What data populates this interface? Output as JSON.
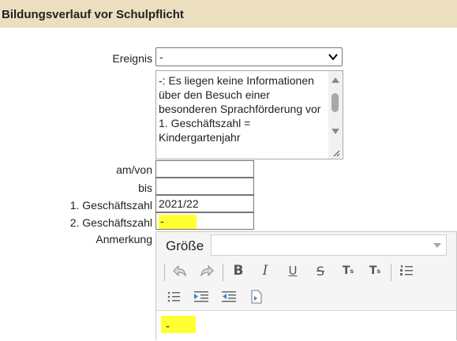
{
  "header": {
    "title": "Bildungsverlauf vor Schulpflicht"
  },
  "form": {
    "ereignis_label": "Ereignis",
    "ereignis_value": "-",
    "description": "-: Es liegen keine Informationen über den Besuch einer besonderen Sprachförderung vor 1. Geschäftszahl = Kindergartenjahr",
    "am_von_label": "am/von",
    "am_von_value": "",
    "bis_label": "bis",
    "bis_value": "",
    "gz1_label": "1. Geschäftszahl",
    "gz1_value": "2021/22",
    "gz2_label": "2. Geschäftszahl",
    "gz2_value": "-",
    "anmerkung_label": "Anmerkung"
  },
  "editor": {
    "size_label": "Größe",
    "size_value": "",
    "toolbar": [
      "undo-icon",
      "redo-icon",
      "bold-icon",
      "italic-icon",
      "underline-icon",
      "strikethrough-icon",
      "subscript-icon",
      "superscript-icon",
      "ordered-list-icon",
      "bullet-list-icon",
      "indent-icon",
      "outdent-icon",
      "insert-template-icon"
    ],
    "content": "-"
  },
  "colors": {
    "header_bg": "#ecdfbf",
    "highlight": "#ffff33"
  }
}
